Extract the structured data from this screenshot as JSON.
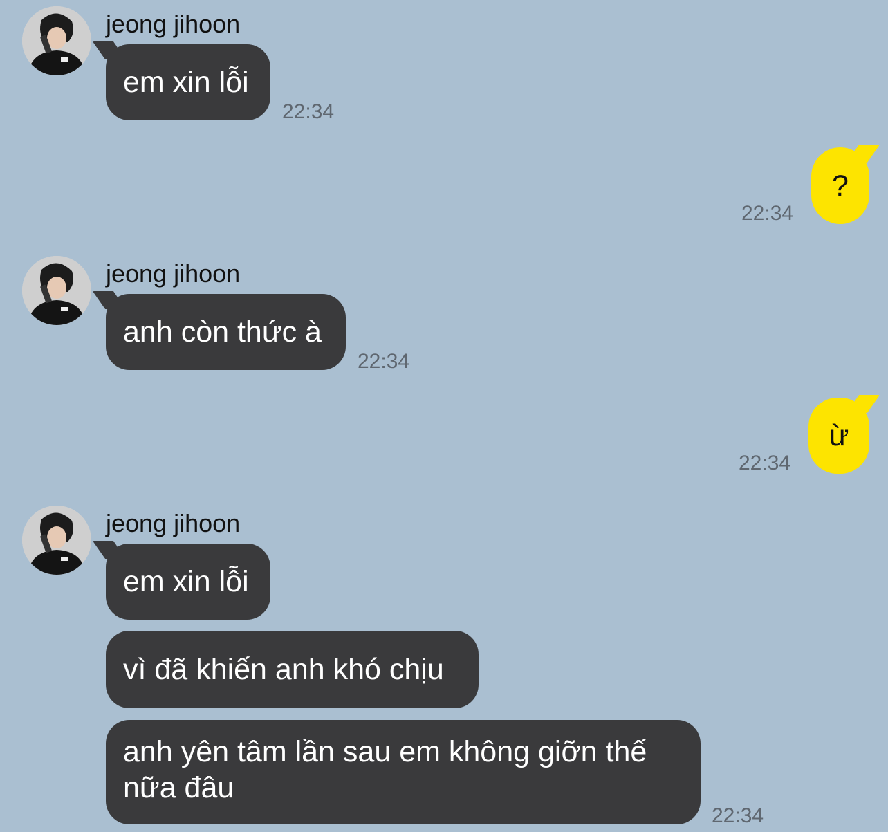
{
  "conversation": {
    "messages": [
      {
        "sender": "jeong jihoon",
        "direction": "incoming",
        "text": "em xin lỗi",
        "time": "22:34"
      },
      {
        "direction": "outgoing",
        "text": "?",
        "time": "22:34"
      },
      {
        "sender": "jeong jihoon",
        "direction": "incoming",
        "text": "anh còn thức à",
        "time": "22:34"
      },
      {
        "direction": "outgoing",
        "text": "ừ",
        "time": "22:34"
      },
      {
        "sender": "jeong jihoon",
        "direction": "incoming",
        "text": "em xin lỗi"
      },
      {
        "direction": "incoming",
        "text": "vì đã khiến anh khó chịu"
      },
      {
        "direction": "incoming",
        "text": "anh yên tâm lần sau em không giỡn thế nữa đâu",
        "time": "22:34"
      }
    ]
  },
  "colors": {
    "background": "#aabfd1",
    "incoming_bubble": "#3a3a3c",
    "outgoing_bubble": "#fde400"
  },
  "icons": {
    "avatar": "contact-avatar-photo"
  }
}
